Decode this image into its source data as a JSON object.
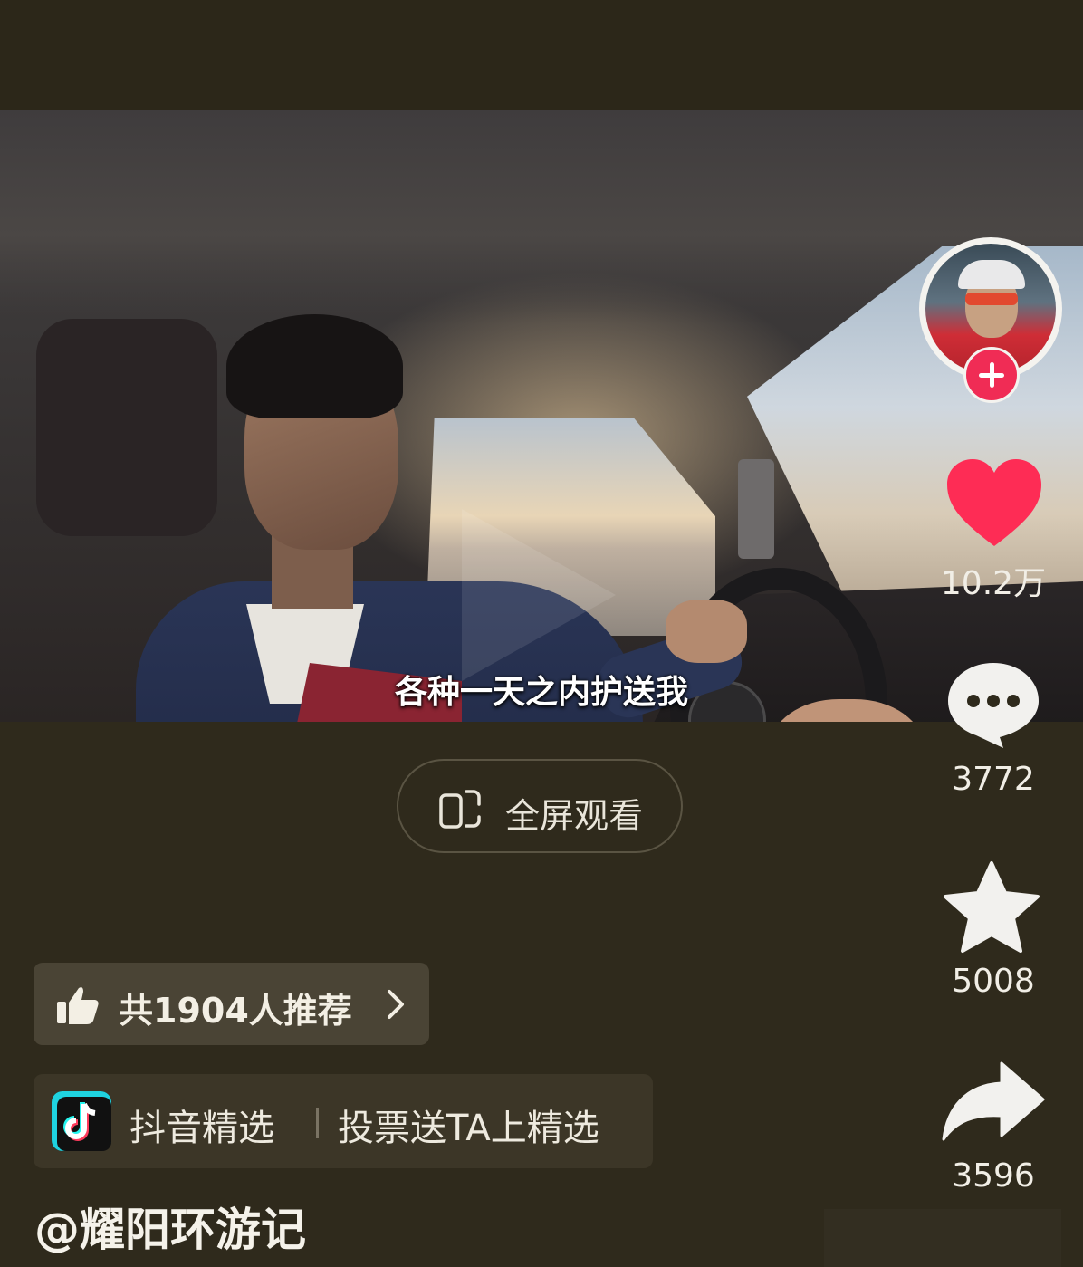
{
  "video": {
    "subtitle": "各种一天之内护送我"
  },
  "fullscreen": {
    "label": "全屏观看",
    "icon": "rotate-screen-icon"
  },
  "recommend": {
    "label": "共1904人推荐",
    "icon": "thumbs-up-icon",
    "chevron_icon": "chevron-right-icon"
  },
  "douyin_select": {
    "brand_label": "抖音精选",
    "action_label": "投票送TA上精选",
    "logo_icon": "douyin-logo-icon"
  },
  "author": {
    "handle": "@耀阳环游记"
  },
  "actions": {
    "like": {
      "icon": "heart-icon",
      "count": "10.2万",
      "color": "#fe2c55"
    },
    "comment": {
      "icon": "comment-icon",
      "count": "3772"
    },
    "favorite": {
      "icon": "star-icon",
      "count": "5008"
    },
    "share": {
      "icon": "share-icon",
      "count": "3596"
    },
    "follow": {
      "icon": "plus-icon",
      "color": "#f02c55"
    }
  },
  "colors": {
    "background": "#2f2a1c",
    "accent": "#fe2c55"
  }
}
